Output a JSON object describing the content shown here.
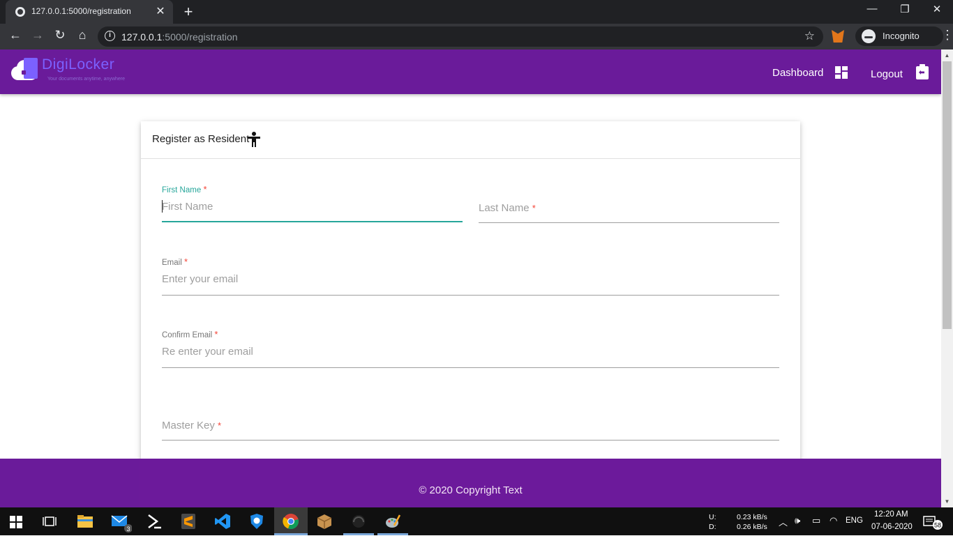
{
  "browser": {
    "tab_title": "127.0.0.1:5000/registration",
    "tab_close": "✕",
    "new_tab": "+",
    "url_host": "127.0.0.1",
    "url_path": ":5000/registration",
    "profile_label": "Incognito",
    "win_minimize": "—",
    "win_restore": "❐",
    "win_close": "✕",
    "back": "←",
    "forward": "→",
    "reload": "↻",
    "home": "⌂",
    "star": "☆",
    "menu": "⋮"
  },
  "app": {
    "brand": "DigiLocker",
    "tagline": "Your documents anytime, anywhere",
    "nav": {
      "dashboard": "Dashboard",
      "logout": "Logout"
    }
  },
  "card": {
    "title": "Register as Resident"
  },
  "form": {
    "first_name": {
      "label": "First Name",
      "required": "*",
      "placeholder": "First Name",
      "value": ""
    },
    "last_name": {
      "label": "Last Name",
      "required": "*",
      "value": ""
    },
    "email": {
      "label": "Email",
      "required": "*",
      "placeholder": "Enter your email",
      "value": ""
    },
    "confirm_email": {
      "label": "Confirm Email",
      "required": "*",
      "placeholder": "Re enter your email",
      "value": ""
    },
    "master_key": {
      "label": "Master Key",
      "required": "*",
      "value": ""
    }
  },
  "footer": {
    "copyright": "© 2020 Copyright Text"
  },
  "taskbar": {
    "mail_badge": "3",
    "net_upload_label": "U:",
    "net_download_label": "D:",
    "net_upload": "0.23 kB/s",
    "net_download": "0.26 kB/s",
    "language": "ENG",
    "time": "12:20 AM",
    "date": "07-06-2020",
    "notification_count": "58"
  },
  "colors": {
    "primary": "#6a1b9a",
    "accent": "#26a69a",
    "required": "#f44336"
  }
}
